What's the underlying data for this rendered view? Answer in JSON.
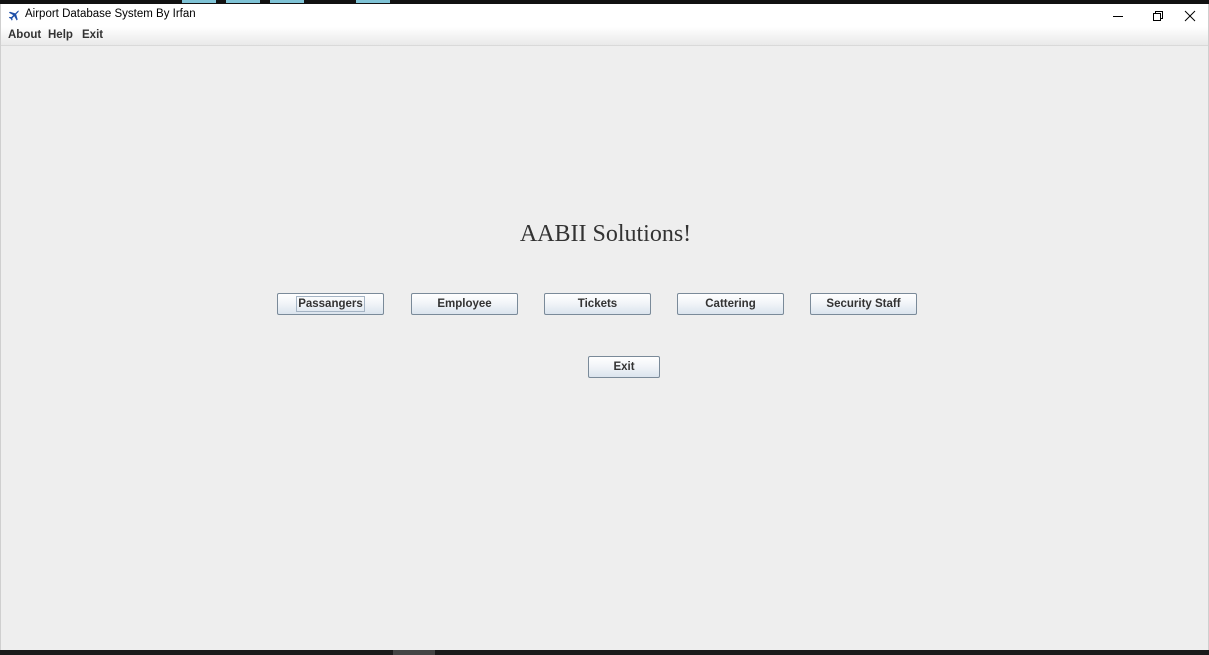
{
  "window": {
    "title": "Airport Database System By Irfan"
  },
  "menu": {
    "items": [
      "About",
      "Help",
      "Exit"
    ]
  },
  "main": {
    "heading": "AABII Solutions!",
    "buttons": [
      "Passangers",
      "Employee",
      "Tickets",
      "Cattering",
      "Security Staff"
    ],
    "exit_button": "Exit"
  },
  "icons": {
    "app": "airplane-icon",
    "minimize": "minimize-icon",
    "restore": "restore-icon",
    "close": "close-icon"
  },
  "colors": {
    "app_icon": "#1e4fa8",
    "window_background": "#eeeeee",
    "button_border": "#7a8a99"
  }
}
